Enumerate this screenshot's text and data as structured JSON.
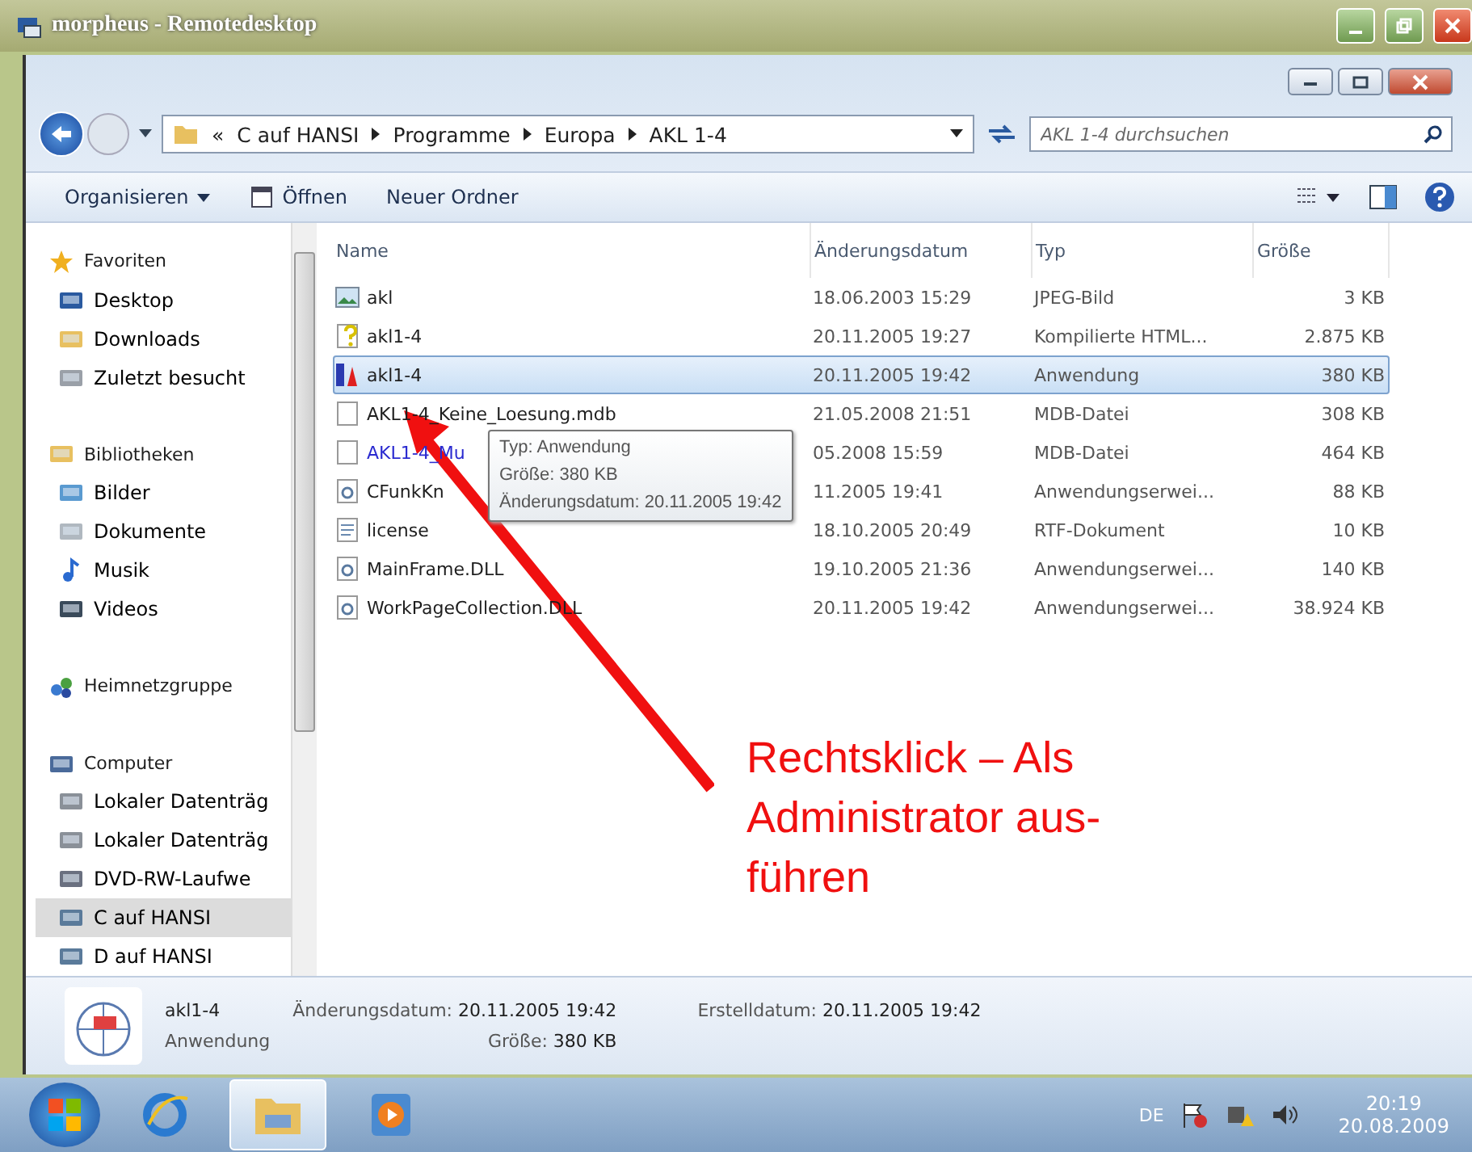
{
  "remote_window": {
    "title": "morpheus - Remotedesktop"
  },
  "explorer": {
    "breadcrumbs": [
      "C auf HANSI",
      "Programme",
      "Europa",
      "AKL 1-4"
    ],
    "overflow": "«",
    "search_placeholder": "AKL 1-4 durchsuchen",
    "toolbar": [
      {
        "label": "Organisieren",
        "kind": "menu"
      },
      {
        "label": "Öffnen",
        "kind": "open"
      },
      {
        "label": "Neuer Ordner",
        "kind": "plain"
      }
    ],
    "sidebar": [
      {
        "label": "Favoriten",
        "kind": "star",
        "children": [
          {
            "label": "Desktop",
            "kind": "desktop",
            "selected": false
          },
          {
            "label": "Downloads",
            "kind": "folder",
            "selected": false
          },
          {
            "label": "Zuletzt besucht",
            "kind": "recent",
            "selected": false
          }
        ]
      },
      {
        "label": "Bibliotheken",
        "kind": "library",
        "children": [
          {
            "label": "Bilder",
            "kind": "image",
            "selected": false
          },
          {
            "label": "Dokumente",
            "kind": "doc",
            "selected": false
          },
          {
            "label": "Musik",
            "kind": "music",
            "selected": false
          },
          {
            "label": "Videos",
            "kind": "video",
            "selected": false
          }
        ]
      },
      {
        "label": "Heimnetzgruppe",
        "kind": "network"
      },
      {
        "label": "Computer",
        "kind": "computer",
        "children": [
          {
            "label": "Lokaler Datenträg",
            "kind": "drive",
            "selected": false
          },
          {
            "label": "Lokaler Datenträg",
            "kind": "drive",
            "selected": false
          },
          {
            "label": "DVD-RW-Laufwe",
            "kind": "dvd",
            "selected": false
          },
          {
            "label": "C auf HANSI",
            "kind": "netdrive",
            "selected": true
          },
          {
            "label": "D auf HANSI",
            "kind": "netdrive",
            "selected": false
          }
        ]
      }
    ],
    "columns": [
      "Name",
      "Änderungsdatum",
      "Typ",
      "Größe"
    ],
    "rows": [
      {
        "name": "akl",
        "date": "18.06.2003 15:29",
        "type": "JPEG-Bild",
        "size": "3 KB",
        "kind": "image",
        "color": "#1e1e1e",
        "selected": false
      },
      {
        "name": "akl1-4",
        "date": "20.11.2005 19:27",
        "type": "Kompilierte HTML...",
        "size": "2.875 KB",
        "kind": "help",
        "color": "#1e1e1e",
        "selected": false
      },
      {
        "name": "akl1-4",
        "date": "20.11.2005 19:42",
        "type": "Anwendung",
        "size": "380 KB",
        "kind": "app",
        "color": "#1e1e1e",
        "selected": true
      },
      {
        "name": "AKL1-4_Keine_Loesung.mdb",
        "date": "21.05.2008 21:51",
        "type": "MDB-Datei",
        "size": "308 KB",
        "kind": "blank",
        "color": "#1e1e1e",
        "selected": false
      },
      {
        "name": "AKL1-4_Mu",
        "date": "05.2008 15:59",
        "type": "MDB-Datei",
        "size": "464 KB",
        "kind": "blank",
        "color": "#2a2ad0",
        "selected": false
      },
      {
        "name": "CFunkKn",
        "date": "11.2005 19:41",
        "type": "Anwendungserwei...",
        "size": "88 KB",
        "kind": "dll",
        "color": "#1e1e1e",
        "selected": false
      },
      {
        "name": "license",
        "date": "18.10.2005 20:49",
        "type": "RTF-Dokument",
        "size": "10 KB",
        "kind": "doc",
        "color": "#1e1e1e",
        "selected": false
      },
      {
        "name": "MainFrame.DLL",
        "date": "19.10.2005 21:36",
        "type": "Anwendungserwei...",
        "size": "140 KB",
        "kind": "dll",
        "color": "#1e1e1e",
        "selected": false
      },
      {
        "name": "WorkPageCollection.DLL",
        "date": "20.11.2005 19:42",
        "type": "Anwendungserwei...",
        "size": "38.924 KB",
        "kind": "dll",
        "color": "#1e1e1e",
        "selected": false
      }
    ],
    "tooltip": [
      "Typ: Anwendung",
      "Größe: 380 KB",
      "Änderungsdatum: 20.11.2005 19:42"
    ],
    "details": {
      "name": "akl1-4",
      "type": "Anwendung",
      "fields": [
        {
          "label": "Änderungsdatum:",
          "value": "20.11.2005 19:42"
        },
        {
          "label": "Größe:",
          "value": "380 KB"
        },
        {
          "label": "Erstelldatum:",
          "value": "20.11.2005 19:42"
        }
      ]
    }
  },
  "annotation": {
    "lines": [
      "Rechtsklick – Als",
      "Administrator aus-",
      "führen"
    ]
  },
  "taskbar": {
    "language": "DE",
    "time": "20:19",
    "date": "20.08.2009",
    "apps": [
      {
        "kind": "ie",
        "selected": false
      },
      {
        "kind": "explorer",
        "selected": true
      },
      {
        "kind": "media",
        "selected": false
      }
    ]
  }
}
